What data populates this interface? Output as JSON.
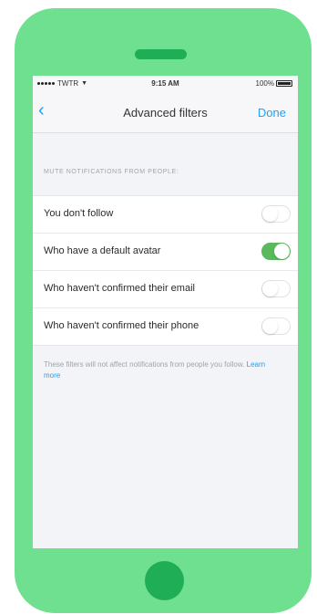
{
  "status_bar": {
    "carrier": "TWTR",
    "time": "9:15 AM",
    "battery": "100%"
  },
  "nav": {
    "title": "Advanced filters",
    "done_label": "Done"
  },
  "section_header": "MUTE NOTIFICATIONS FROM PEOPLE:",
  "filters": [
    {
      "label": "You don't follow",
      "enabled": false
    },
    {
      "label": "Who have a default avatar",
      "enabled": true
    },
    {
      "label": "Who haven't confirmed their email",
      "enabled": false
    },
    {
      "label": "Who haven't confirmed their phone",
      "enabled": false
    }
  ],
  "footer": {
    "note": "These filters will not affect notifications from people you follow.",
    "link": "Learn more"
  },
  "colors": {
    "phone_body": "#6ee08f",
    "phone_accent": "#1fae55",
    "link_blue": "#1da1f2",
    "toggle_on": "#5cb85c"
  },
  "icons": {
    "back": "chevron-left-icon",
    "wifi": "wifi-icon",
    "battery": "battery-icon"
  }
}
